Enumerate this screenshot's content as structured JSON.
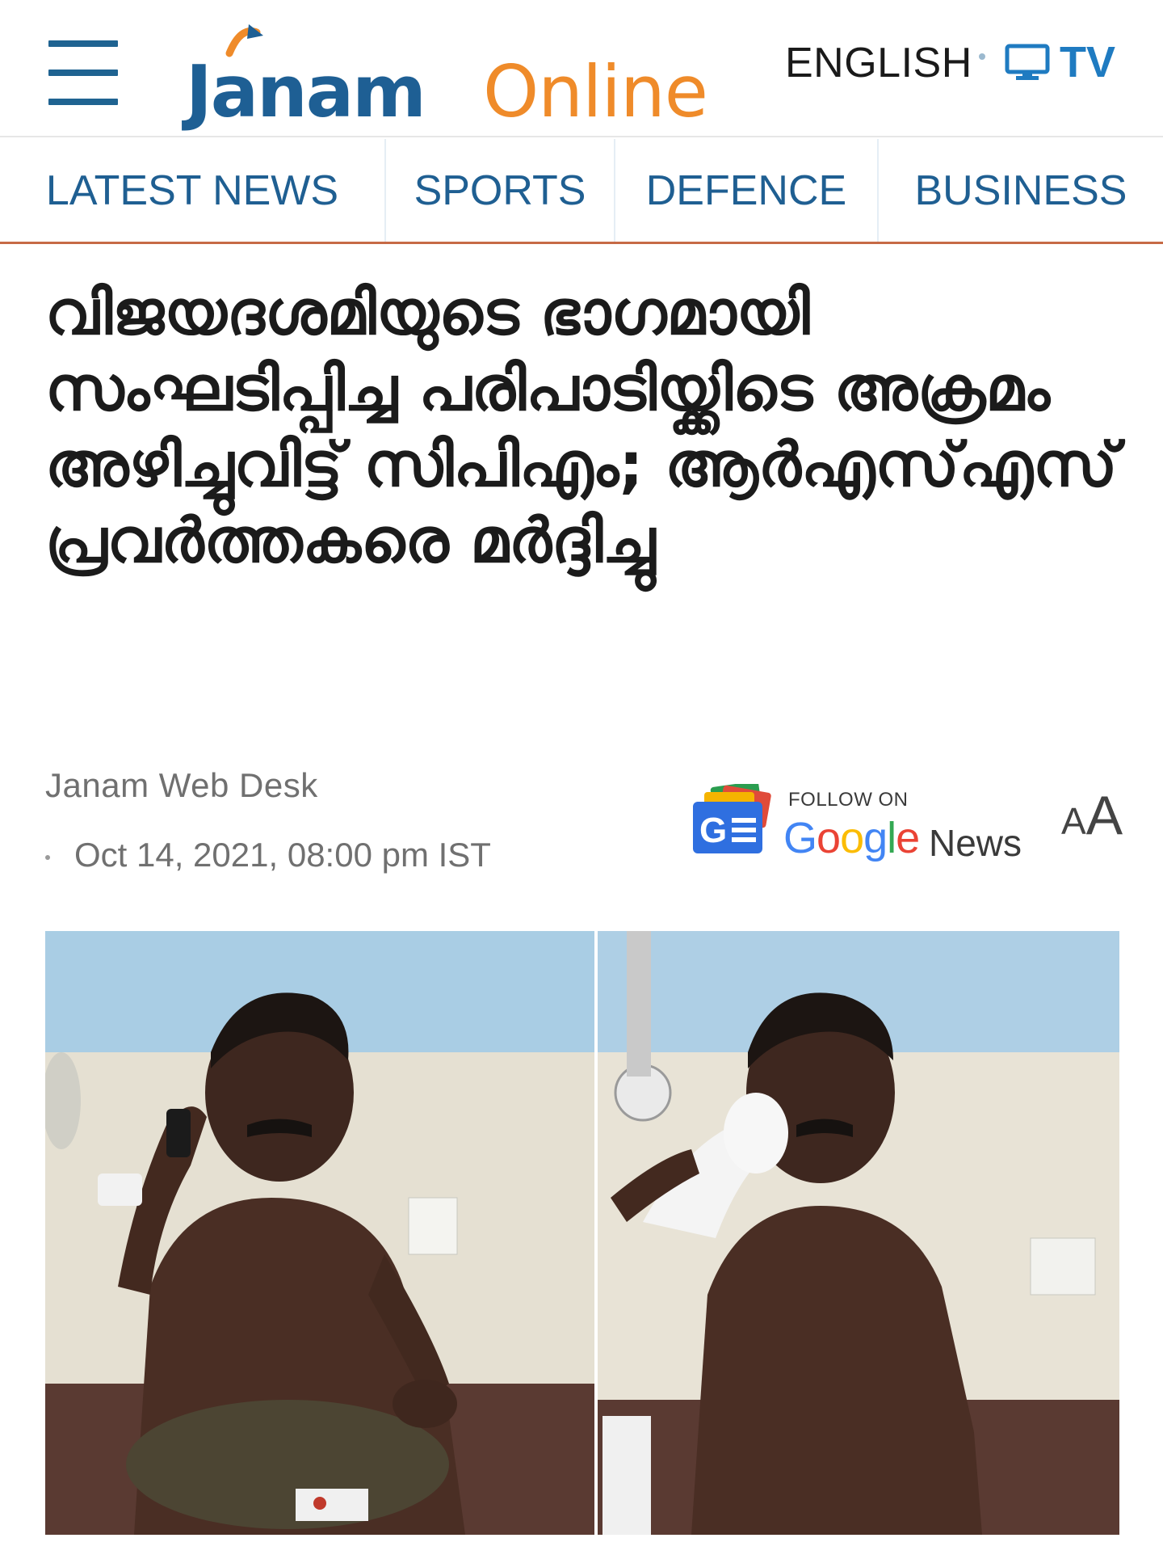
{
  "header": {
    "logo_primary": "Janam",
    "logo_secondary": "Online",
    "lang_label": "ENGLISH",
    "tv_label": "TV"
  },
  "nav": {
    "items": [
      {
        "label": "LATEST NEWS"
      },
      {
        "label": "SPORTS"
      },
      {
        "label": "DEFENCE"
      },
      {
        "label": "BUSINESS"
      }
    ]
  },
  "article": {
    "title": "വിജയദശമിയുടെ ഭാഗമായി സംഘടിപ്പിച്ച പരിപാടിയ്ക്കിടെ അക്രമം അഴിച്ചുവിട്ട് സിപിഎം; ആർഎസ്എസ് പ്രവർത്തകരെ മർദ്ദിച്ചു",
    "author": "Janam Web Desk",
    "date": "Oct 14, 2021, 08:00 pm IST"
  },
  "google_news": {
    "follow_label": "FOLLOW ON",
    "google_letters": [
      "G",
      "o",
      "o",
      "g",
      "l",
      "e"
    ],
    "news_label": "News"
  },
  "font_size_control": {
    "small": "A",
    "large": "A"
  },
  "colors": {
    "brand_blue": "#1e5f94",
    "brand_orange": "#ef8b2a",
    "nav_text": "#1f5f92",
    "nav_underline": "#c66a46",
    "tv_blue": "#1f7bc1"
  }
}
